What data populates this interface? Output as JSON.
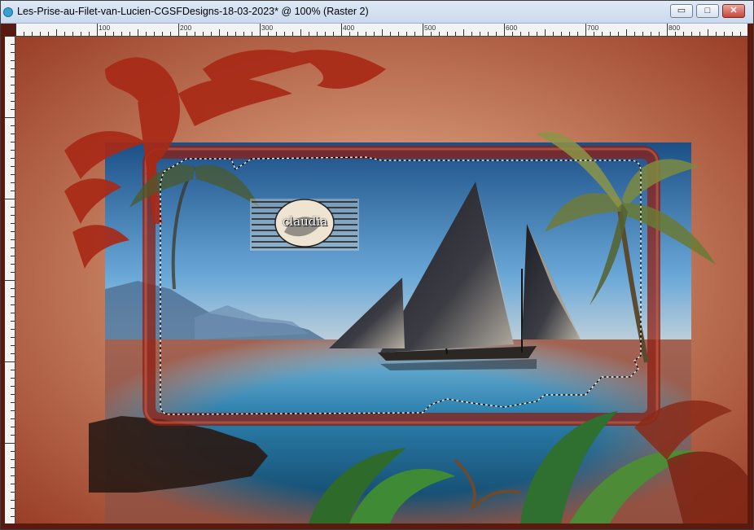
{
  "window": {
    "title": "Les-Prise-au-Filet-van-Lucien-CGSFDesigns-18-03-2023* @ 100% (Raster 2)",
    "controls": {
      "minimize": "▭",
      "maximize": "□",
      "close": "✕"
    }
  },
  "ruler": {
    "labels": [
      "100",
      "200",
      "300",
      "400",
      "500",
      "600",
      "700",
      "800"
    ]
  },
  "watermark": {
    "text": "claudia"
  },
  "colors": {
    "frame": "#a82a17",
    "canvas_bg": "#b46247",
    "sky": "#4d93c8",
    "sea": "#1c6a92"
  }
}
